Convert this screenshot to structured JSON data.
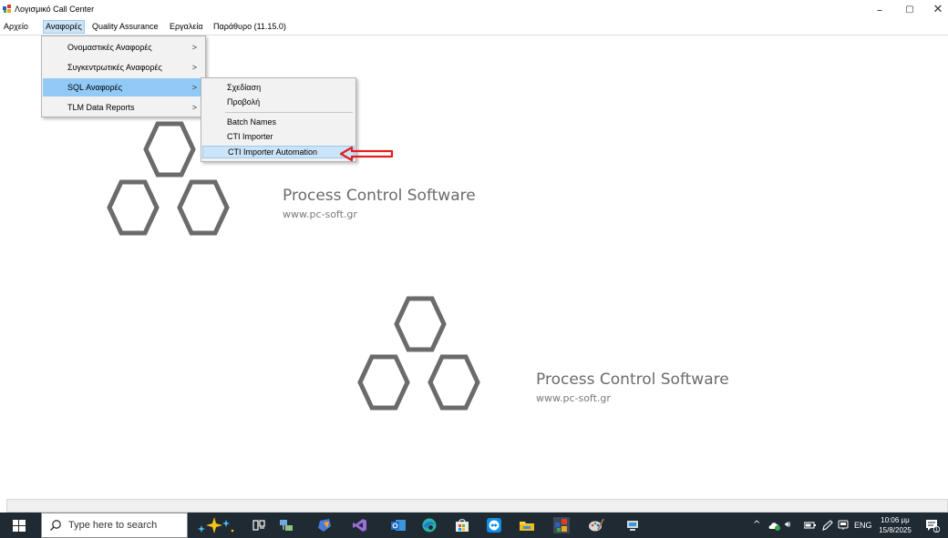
{
  "window": {
    "title": "Λογισμικό Call Center",
    "controls": {
      "minimize": "–",
      "maximize": "▢",
      "close": "✕"
    }
  },
  "menubar": {
    "items": [
      "Αρχείο",
      "Αναφορές",
      "Quality Assurance",
      "Εργαλεία",
      "Παράθυρο (11.15.0)"
    ],
    "active_index": 1
  },
  "reports_menu": {
    "items": [
      {
        "label": "Ονομαστικές Αναφορές",
        "arrow": ">"
      },
      {
        "label": "Συγκεντρωτικές Αναφορές",
        "arrow": ">"
      },
      {
        "label": "SQL Αναφορές",
        "arrow": ">"
      },
      {
        "label": "TLM Data Reports",
        "arrow": ">"
      }
    ],
    "highlighted_index": 2
  },
  "sql_submenu": {
    "items": [
      {
        "label": "Σχεδίαση"
      },
      {
        "label": "Προβολή"
      },
      {
        "label": "Batch Names"
      },
      {
        "label": "CTI Importer"
      },
      {
        "label": "CTI Importer Automation"
      }
    ],
    "highlighted_index": 4
  },
  "logos": [
    {
      "name": "Process Control Software",
      "url": "www.pc-soft.gr"
    },
    {
      "name": "Process Control Software",
      "url": "www.pc-soft.gr"
    }
  ],
  "taskbar": {
    "search_placeholder": "Type here to search",
    "language": "ENG",
    "time": "10:06 μμ",
    "date": "15/8/2025",
    "notification_count": "1"
  },
  "colors": {
    "menu_highlight": "#91c9f7",
    "menu_active": "#cce4f7",
    "logo_gray": "#6b6b6b",
    "arrow_red": "#e02020",
    "taskbar_bg": "#1f2a33"
  }
}
